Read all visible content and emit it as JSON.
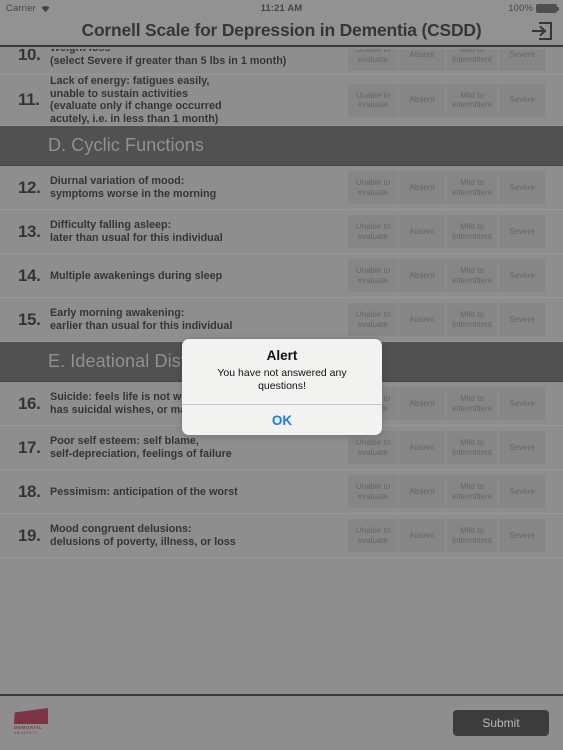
{
  "status_bar": {
    "carrier": "Carrier",
    "wifi_icon": "wifi-icon",
    "time": "11:21 AM",
    "battery_percent": "100%",
    "battery_icon": "battery-full-icon"
  },
  "header": {
    "title": "Cornell Scale for Depression in Dementia (CSDD)",
    "exit_icon": "sign-in-arrow-icon"
  },
  "answer_options": [
    "Unable to evaluate",
    "Absent",
    "Mild to intermittent",
    "Severe"
  ],
  "answer_options_lines": [
    [
      "Unable to",
      "evaluate"
    ],
    [
      "Absent"
    ],
    [
      "Mild to",
      "intermittent"
    ],
    [
      "Severe"
    ]
  ],
  "rows": [
    {
      "type": "question",
      "number": "10.",
      "lines": [
        "Weight loss",
        "(select Severe if greater than 5 lbs in 1 month)"
      ],
      "clipped_top": true
    },
    {
      "type": "question",
      "number": "11.",
      "lines": [
        "Lack of energy: fatigues easily,",
        "unable to sustain activities",
        "(evaluate only if change occurred",
        "acutely, i.e. in less than 1 month)"
      ]
    },
    {
      "type": "section",
      "label": "D. Cyclic Functions"
    },
    {
      "type": "question",
      "number": "12.",
      "lines": [
        "Diurnal variation of mood:",
        "symptoms worse in the morning"
      ]
    },
    {
      "type": "question",
      "number": "13.",
      "lines": [
        "Difficulty falling asleep:",
        "later than usual for this individual"
      ]
    },
    {
      "type": "question",
      "number": "14.",
      "lines": [
        "Multiple awakenings during sleep"
      ]
    },
    {
      "type": "question",
      "number": "15.",
      "lines": [
        "Early morning awakening:",
        "earlier than usual for this individual"
      ]
    },
    {
      "type": "section",
      "label": "E. Ideational Disturbance"
    },
    {
      "type": "question",
      "number": "16.",
      "lines": [
        "Suicide: feels life is not worth living,",
        "has suicidal wishes, or makes suicide attempt"
      ]
    },
    {
      "type": "question",
      "number": "17.",
      "lines": [
        "Poor self esteem: self blame,",
        "self-depreciation, feelings of failure"
      ]
    },
    {
      "type": "question",
      "number": "18.",
      "lines": [
        "Pessimism: anticipation of the worst"
      ]
    },
    {
      "type": "question",
      "number": "19.",
      "lines": [
        "Mood congruent delusions:",
        "delusions of poverty, illness, or loss"
      ]
    }
  ],
  "footer": {
    "logo_name": "memorial-university-logo",
    "logo_line1": "MEMORIAL",
    "logo_line2": "UNIVERSITY",
    "submit_label": "Submit"
  },
  "alert": {
    "title": "Alert",
    "message": "You have not answered any questions!",
    "ok_label": "OK"
  },
  "colors": {
    "page_bg": "#9a9a9a",
    "section_bg": "#3d3d3d",
    "section_text": "#9e9e9e",
    "answer_bg": "#8d8d8d",
    "answer_text": "#5c5c5c",
    "submit_bg": "#1d1d1d",
    "alert_accent": "#1b7af7",
    "logo_red": "#7d1128"
  }
}
